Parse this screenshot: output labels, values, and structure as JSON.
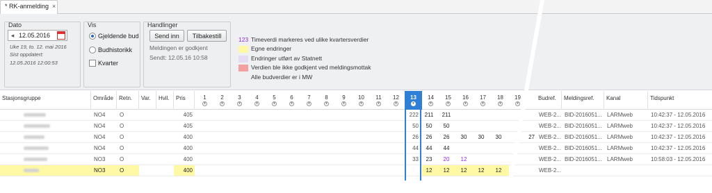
{
  "tab": {
    "title": "* RK-anmelding",
    "close": "×"
  },
  "dato": {
    "title": "Dato",
    "date_value": "12.05.2016",
    "week_text": "Uke 19, to. 12. mai 2016",
    "last_updated_label": "Sist oppdatert:",
    "last_updated_value": "12.05.2016 12:00:53"
  },
  "vis": {
    "title": "Vis",
    "options": [
      "Gjeldende bud",
      "Budhistorikk"
    ],
    "selected": "Gjeldende bud",
    "checkbox_label": "Kvarter"
  },
  "handlinger": {
    "title": "Handlinger",
    "send_label": "Send inn",
    "reset_label": "Tilbakestill",
    "status": "Meldingen er godkjent",
    "sent": "Sendt: 12.05.16 10:58"
  },
  "legend": {
    "number_sample": "123",
    "items": [
      {
        "text": "Timeverdi markeres ved ulike kvartersverdier",
        "color": ""
      },
      {
        "text": "Egne endringer",
        "color": "#fff9a6"
      },
      {
        "text": "Endringer utført av Statnett",
        "color": "#e6dcf2"
      },
      {
        "text": "Verdien ble ikke godkjent ved meldingsmottak",
        "color": "#f2a0a0"
      },
      {
        "text": "Alle budverdier er i MW",
        "color": ""
      }
    ]
  },
  "columns": {
    "stasjonsgruppe": "Stasjonsgruppe",
    "omrade": "Område",
    "retn": "Retn.",
    "var": "Var.",
    "hvil": "Hvil.",
    "pris": "Pris",
    "hours": [
      "1",
      "2",
      "3",
      "4",
      "5",
      "6",
      "7",
      "8",
      "9",
      "10",
      "11",
      "12",
      "13",
      "14",
      "15",
      "16",
      "17",
      "18",
      "19"
    ],
    "active_hour": "13",
    "budref": "Budref.",
    "meldingref": "Meldingsref.",
    "kanal": "Kanal",
    "tidspunkt": "Tidspunkt"
  },
  "rows": [
    {
      "omrade": "NO4",
      "retn": "O",
      "pris": "405",
      "h13": "222",
      "h14": "211",
      "h15": "211",
      "h16": "",
      "h17": "",
      "h18": "",
      "h19": "",
      "extra": "",
      "budref": "WEB-2...",
      "meldingref": "BID-2016051...",
      "kanal": "LARMweb",
      "tidspunkt": "10:42:37 - 12.05.2016"
    },
    {
      "omrade": "NO4",
      "retn": "O",
      "pris": "405",
      "h13": "50",
      "h14": "50",
      "h15": "50",
      "h16": "",
      "h17": "",
      "h18": "",
      "h19": "",
      "extra": "",
      "budref": "WEB-2...",
      "meldingref": "BID-2016051...",
      "kanal": "LARMweb",
      "tidspunkt": "10:42:37 - 12.05.2016"
    },
    {
      "omrade": "NO4",
      "retn": "O",
      "pris": "400",
      "h13": "26",
      "h14": "26",
      "h15": "26",
      "h16": "30",
      "h17": "30",
      "h18": "30",
      "h19": "",
      "extra": "27",
      "budref": "WEB-2...",
      "meldingref": "BID-2016051...",
      "kanal": "LARMweb",
      "tidspunkt": "10:42:37 - 12.05.2016"
    },
    {
      "omrade": "NO4",
      "retn": "O",
      "pris": "400",
      "h13": "44",
      "h14": "44",
      "h15": "44",
      "h16": "",
      "h17": "",
      "h18": "",
      "h19": "",
      "extra": "",
      "budref": "WEB-2...",
      "meldingref": "BID-2016051...",
      "kanal": "LARMweb",
      "tidspunkt": "10:42:37 - 12.05.2016"
    },
    {
      "omrade": "NO3",
      "retn": "O",
      "pris": "400",
      "h13": "33",
      "h14": "23",
      "h15": "20",
      "h16": "12",
      "h17": "",
      "h18": "",
      "h19": "",
      "extra": "",
      "budref": "WEB-2...",
      "meldingref": "BID-2016051...",
      "kanal": "LARMweb",
      "tidspunkt": "10:58:03 - 12.05.2016"
    },
    {
      "omrade": "NO3",
      "retn": "O",
      "pris": "400",
      "h13": "",
      "h14": "12",
      "h15": "12",
      "h16": "12",
      "h17": "12",
      "h18": "12",
      "h19": "",
      "extra": "",
      "budref": "WEB-2...",
      "meldingref": "",
      "kanal": "",
      "tidspunkt": ""
    }
  ],
  "colors": {
    "accent": "#2f7fd6",
    "own_change": "#fff9a6",
    "purple_value": "#8a2be2"
  }
}
